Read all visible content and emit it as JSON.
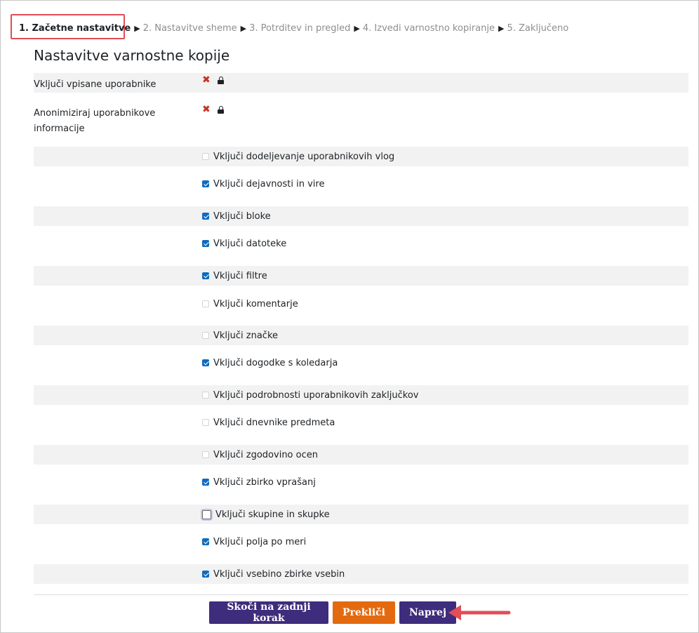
{
  "steps": [
    {
      "label": "1. Začetne nastavitve",
      "current": true
    },
    {
      "label": "2. Nastavitve sheme",
      "current": false
    },
    {
      "label": "3. Potrditev in pregled",
      "current": false
    },
    {
      "label": "4. Izvedi varnostno kopiranje",
      "current": false
    },
    {
      "label": "5. Zaključeno",
      "current": false
    }
  ],
  "step_separator": "▶",
  "heading": "Nastavitve varnostne kopije",
  "locked_settings": [
    {
      "label": "Vključi vpisane uporabnike",
      "state": "x-icon",
      "locked": true
    },
    {
      "label": "Anonimiziraj uporabnikove informacije",
      "state": "x-icon",
      "locked": true
    }
  ],
  "options": [
    {
      "label": "Vključi dodeljevanje uporabnikovih vlog",
      "checked": false
    },
    {
      "label": "Vključi dejavnosti in vire",
      "checked": true
    },
    {
      "label": "Vključi bloke",
      "checked": true
    },
    {
      "label": "Vključi datoteke",
      "checked": true
    },
    {
      "label": "Vključi filtre",
      "checked": true
    },
    {
      "label": "Vključi komentarje",
      "checked": false
    },
    {
      "label": "Vključi značke",
      "checked": false
    },
    {
      "label": "Vključi dogodke s koledarja",
      "checked": true
    },
    {
      "label": "Vključi podrobnosti uporabnikovih zaključkov",
      "checked": false
    },
    {
      "label": "Vključi dnevnike predmeta",
      "checked": false
    },
    {
      "label": "Vključi zgodovino ocen",
      "checked": false
    },
    {
      "label": "Vključi zbirko vprašanj",
      "checked": true
    },
    {
      "label": "Vključi skupine in skupke",
      "checked": false
    },
    {
      "label": "Vključi polja po meri",
      "checked": true
    },
    {
      "label": "Vključi vsebino zbirke vsebin",
      "checked": true
    }
  ],
  "buttons": {
    "skip": "Skoči na zadnji korak",
    "cancel": "Prekliči",
    "next": "Naprej"
  },
  "colors": {
    "primary": "#3e2c7c",
    "cancel": "#e46a0f",
    "checkbox": "#0f6cbf",
    "annotation": "#e24d56"
  }
}
